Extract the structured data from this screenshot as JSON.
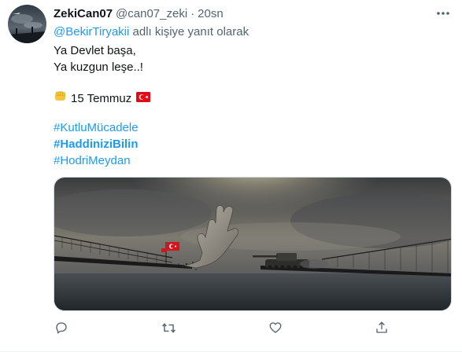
{
  "tweet": {
    "display_name": "ZekiCan07",
    "handle": "@can07_zeki",
    "separator": "·",
    "time": "20sn",
    "reply_to": {
      "mention": "@BekirTiryakii",
      "suffix": "adlı kişiye yanıt olarak"
    },
    "lines": [
      "Ya Devlet başa,",
      "Ya kuzgun leşe..!"
    ],
    "date_text": "15 Temmuz",
    "hashtags": [
      "#KutluMücadele",
      "#HaddiniziBilin",
      "#HodriMeydan"
    ],
    "icons": {
      "more": "more-icon",
      "fist": "fist-emoji-icon",
      "flag": "turkish-flag-emoji-icon",
      "reply": "reply-icon",
      "retweet": "retweet-icon",
      "like": "like-icon",
      "share": "share-icon"
    },
    "colors": {
      "link": "#1d9bf0",
      "secondary": "#536471",
      "primary": "#0f1419"
    }
  }
}
